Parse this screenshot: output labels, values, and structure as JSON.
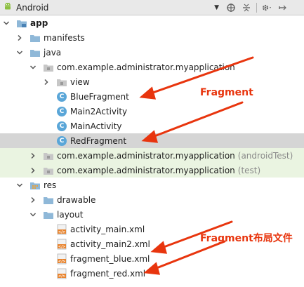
{
  "toolbar": {
    "view_selector_label": "Android",
    "icons": [
      "android-icon",
      "dropdown-arrow-icon",
      "sync-icon",
      "collapse-icon",
      "settings-icon",
      "hide-icon"
    ]
  },
  "tree": {
    "rows": [
      {
        "label": "app",
        "depth": 0,
        "expanded": true,
        "icon": "module-folder-icon",
        "bold": true
      },
      {
        "label": "manifests",
        "depth": 1,
        "expanded": false,
        "icon": "folder-icon"
      },
      {
        "label": "java",
        "depth": 1,
        "expanded": true,
        "icon": "folder-icon"
      },
      {
        "label": "com.example.administrator.myapplication",
        "depth": 2,
        "expanded": true,
        "icon": "package-icon"
      },
      {
        "label": "view",
        "depth": 3,
        "expanded": false,
        "icon": "package-icon"
      },
      {
        "label": "BlueFragment",
        "depth": 3,
        "icon": "class-icon"
      },
      {
        "label": "Main2Activity",
        "depth": 3,
        "icon": "class-icon"
      },
      {
        "label": "MainActivity",
        "depth": 3,
        "icon": "class-icon"
      },
      {
        "label": "RedFragment",
        "depth": 3,
        "icon": "class-icon",
        "selected": true
      },
      {
        "label": "com.example.administrator.myapplication",
        "suffix": "(androidTest)",
        "depth": 2,
        "expanded": false,
        "icon": "package-icon",
        "tinted": true
      },
      {
        "label": "com.example.administrator.myapplication",
        "suffix": "(test)",
        "depth": 2,
        "expanded": false,
        "icon": "package-icon",
        "tinted": true
      },
      {
        "label": "res",
        "depth": 1,
        "expanded": true,
        "icon": "res-folder-icon"
      },
      {
        "label": "drawable",
        "depth": 2,
        "expanded": false,
        "icon": "folder-icon"
      },
      {
        "label": "layout",
        "depth": 2,
        "expanded": true,
        "icon": "folder-icon"
      },
      {
        "label": "activity_main.xml",
        "depth": 3,
        "icon": "xml-file-icon"
      },
      {
        "label": "activity_main2.xml",
        "depth": 3,
        "icon": "xml-file-icon"
      },
      {
        "label": "fragment_blue.xml",
        "depth": 3,
        "icon": "xml-file-icon"
      },
      {
        "label": "fragment_red.xml",
        "depth": 3,
        "icon": "xml-file-icon"
      }
    ]
  },
  "annotations": {
    "fragment_label": "Fragment",
    "fragment_layout_label": "Fragment布局文件"
  },
  "colors": {
    "annotation": "#e8350e",
    "selected_row": "#d5d5d5",
    "test_row": "#eaf4e1",
    "class_icon": "#5aa6d8",
    "folder_icon": "#8fb8d8"
  }
}
